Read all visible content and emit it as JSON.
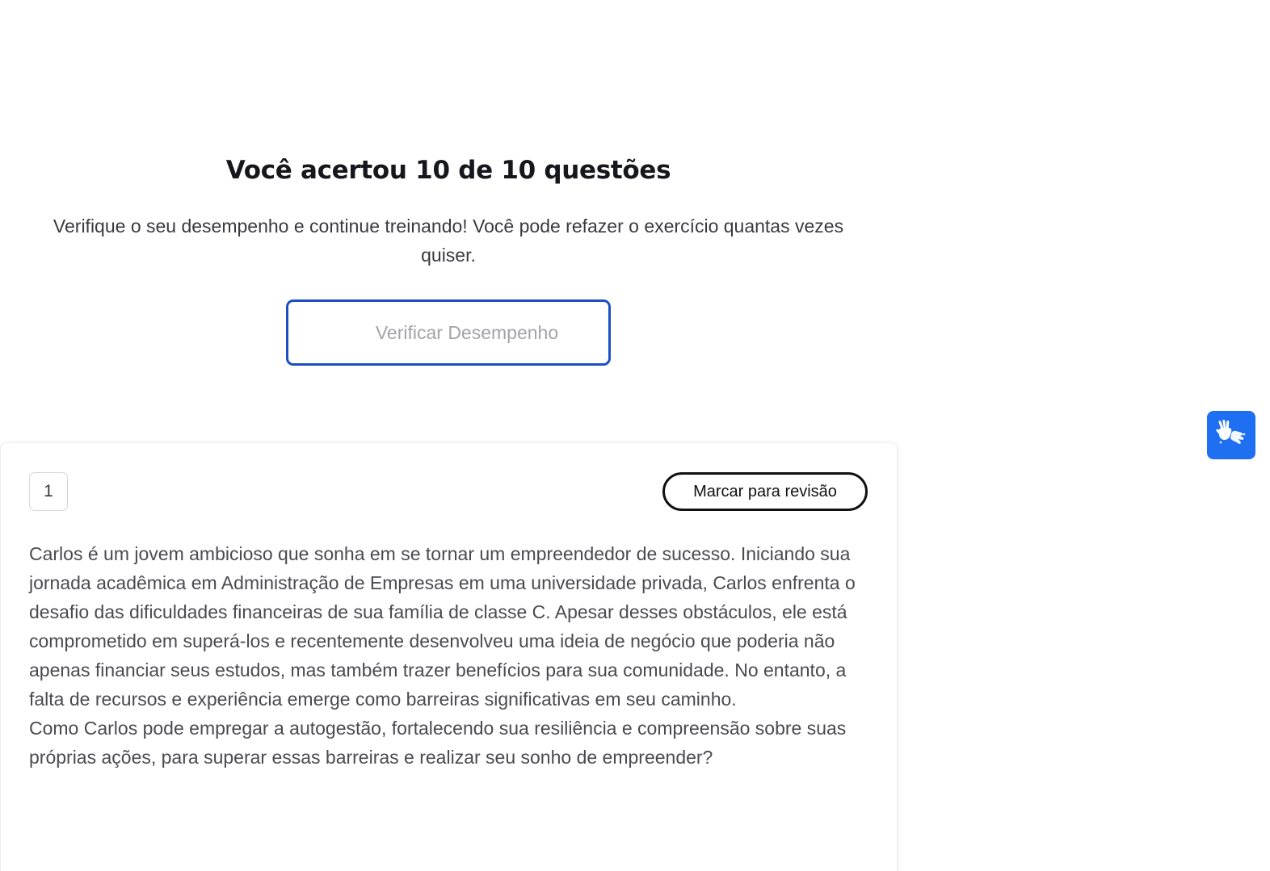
{
  "result": {
    "title": "Você acertou 10 de 10 questões",
    "subtitle": "Verifique o seu desempenho e continue treinando! Você pode refazer o exercício quantas vezes quiser.",
    "verify_button_label": "Verificar Desempenho"
  },
  "question": {
    "number": "1",
    "review_button_label": "Marcar para revisão",
    "context": "Carlos é um jovem ambicioso que sonha em se tornar um empreendedor de sucesso. Iniciando sua jornada acadêmica em Administração de Empresas em uma universidade privada, Carlos enfrenta o desafio das dificuldades financeiras de sua família de classe C. Apesar desses obstáculos, ele está comprometido em superá-los e recentemente desenvolveu uma ideia de negócio que poderia não apenas financiar seus estudos, mas também trazer benefícios para sua comunidade. No entanto, a falta de recursos e experiência emerge como barreiras significativas em seu caminho.",
    "prompt": "Como Carlos pode empregar a autogestão, fortalecendo sua resiliência e compreensão sobre suas próprias ações, para superar essas barreiras e realizar seu sonho de empreender?"
  },
  "accessibility_widget": {
    "icon": "sign-language-hands-icon",
    "color": "#1f6ff2"
  },
  "colors": {
    "accent": "#1b4fc4",
    "title_text": "#16161d",
    "body_text": "#4a4a50"
  }
}
